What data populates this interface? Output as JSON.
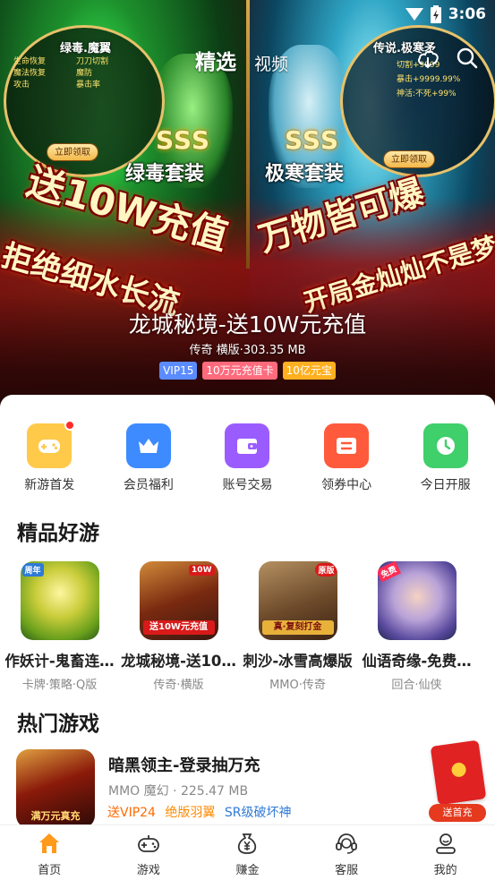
{
  "status_bar": {
    "time": "3:06"
  },
  "top_tabs": [
    {
      "label": "精选",
      "active": true
    },
    {
      "label": "视频",
      "active": false
    }
  ],
  "banner": {
    "title": "龙城秘境-送10W元充值",
    "meta": "传奇 横版·303.35 MB",
    "tags": [
      "VIP15",
      "10万元充值卡",
      "10亿元宝"
    ],
    "left_panel": {
      "bubble_title": "绿毒.魔翼",
      "stats": [
        "生命恢复",
        "魔法恢复",
        "攻击",
        "刀刀切割",
        "魔防",
        "暴击率"
      ],
      "claim": "立即领取",
      "grade": "SSS",
      "set_name": "绿毒套装"
    },
    "right_panel": {
      "bubble_title": "传说.极寒矛",
      "stats": [
        "切割+9999",
        "暴击+9999.99%",
        "神活:不死+99%"
      ],
      "claim": "立即领取",
      "grade": "SSS",
      "set_name": "极寒套装"
    },
    "slogans": [
      "送10W充值",
      "拒绝细水长流",
      "万物皆可爆",
      "开局金灿灿不是梦"
    ]
  },
  "quick_entries": [
    {
      "label": "新游首发",
      "icon": "gamepad-icon",
      "color": "#ffc94a",
      "badge": true
    },
    {
      "label": "会员福利",
      "icon": "crown-icon",
      "color": "#3d8bff",
      "badge": false
    },
    {
      "label": "账号交易",
      "icon": "wallet-icon",
      "color": "#9b5cff",
      "badge": false
    },
    {
      "label": "领券中心",
      "icon": "coupon-icon",
      "color": "#ff5a3c",
      "badge": false
    },
    {
      "label": "今日开服",
      "icon": "clock-icon",
      "color": "#3fcf6b",
      "badge": false
    }
  ],
  "featured": {
    "title": "精品好游",
    "games": [
      {
        "name": "作妖计-鬼畜连…",
        "tags": "卡牌·策略·Q版",
        "thumb_badge": "周年"
      },
      {
        "name": "龙城秘境-送10…",
        "tags": "传奇·横版",
        "thumb_badge": "10W",
        "thumb_label": "送10W元充值"
      },
      {
        "name": "刺沙-冰雪高爆版",
        "tags": "MMO·传奇",
        "thumb_badge": "原版",
        "thumb_label": "真·复刻打金"
      },
      {
        "name": "仙语奇缘-免费…",
        "tags": "回合·仙侠",
        "thumb_badge": "免费"
      }
    ]
  },
  "hot": {
    "title": "热门游戏",
    "game": {
      "name": "暗黑领主-登录抽万充",
      "meta": "MMO 魔幻 · 225.47 MB",
      "tags": [
        "送VIP24",
        "绝版羽翼",
        "SR级破坏神"
      ],
      "thumb_label": "满万元真充"
    },
    "gift_button": "送首充"
  },
  "bottom_nav": [
    {
      "label": "首页",
      "icon": "home-icon",
      "active": true
    },
    {
      "label": "游戏",
      "icon": "gamepad-icon",
      "active": false
    },
    {
      "label": "赚金",
      "icon": "money-bag-icon",
      "active": false
    },
    {
      "label": "客服",
      "icon": "headset-icon",
      "active": false
    },
    {
      "label": "我的",
      "icon": "user-icon",
      "active": false
    }
  ],
  "colors": {
    "accent": "#ff9a1a",
    "tag_vip": "#5b8cff",
    "tag_card": "#ff6b7d",
    "tag_gold": "#ffb020"
  }
}
